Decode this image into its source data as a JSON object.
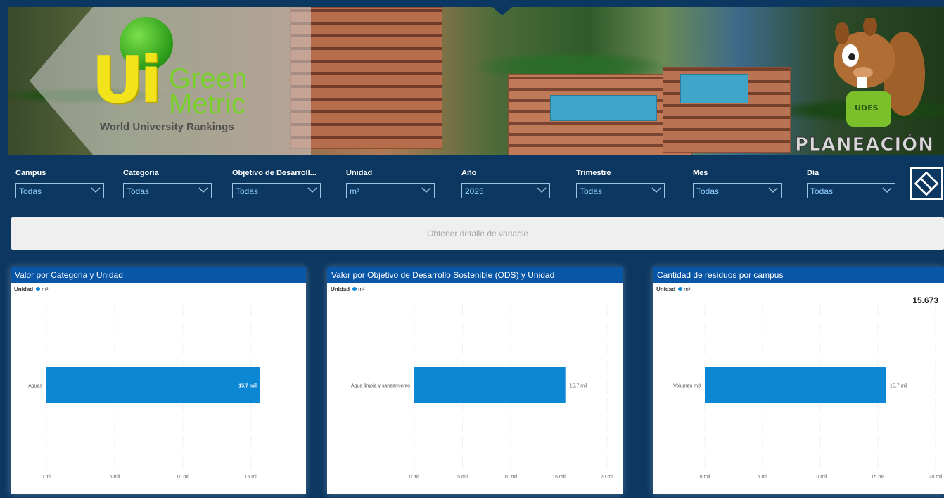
{
  "banner": {
    "logo_ui": "Ui",
    "logo_green": "Green",
    "logo_metric": "Metric",
    "logo_subtitle": "World University Rankings",
    "mascot_shirt": "UDES",
    "section_title": "PLANEACIÓN"
  },
  "filters": [
    {
      "label": "Campus",
      "value": "Todas"
    },
    {
      "label": "Categoria",
      "value": "Todas"
    },
    {
      "label": "Objetivo de Desarroll...",
      "value": "Todas"
    },
    {
      "label": "Unidad",
      "value": "m³"
    },
    {
      "label": "Año",
      "value": "2025"
    },
    {
      "label": "Trimestre",
      "value": "Todas"
    },
    {
      "label": "Mes",
      "value": "Todas"
    },
    {
      "label": "Día",
      "value": "Todas"
    }
  ],
  "clear_filters_icon": "eraser-icon",
  "detail_button": "Obtener detalle de variable",
  "colors": {
    "header": "#0a56a6",
    "bar": "#0c87d4",
    "background": "#0b3760"
  },
  "cards": [
    {
      "title": "Valor por Categoria y Unidad",
      "legend_title": "Unidad",
      "legend_item": "m³",
      "kpi": ""
    },
    {
      "title": "Valor por Objetivo de Desarrollo Sostenible (ODS) y Unidad",
      "legend_title": "Unidad",
      "legend_item": "m³",
      "kpi": ""
    },
    {
      "title": "Cantidad de residuos por campus",
      "legend_title": "Unidad",
      "legend_item": "m³",
      "kpi": "15.673"
    }
  ],
  "chart_data": [
    {
      "type": "bar",
      "orientation": "horizontal",
      "categories": [
        "Aguas"
      ],
      "series": [
        {
          "name": "m³",
          "values": [
            15673
          ]
        }
      ],
      "data_labels": [
        "15,7 mil"
      ],
      "xticks": [
        "0 mil",
        "5 mil",
        "10 mil",
        "15 mil"
      ],
      "xlim": [
        0,
        16500
      ],
      "grid": true
    },
    {
      "type": "bar",
      "orientation": "horizontal",
      "categories": [
        "Agua limpia y saneamiento"
      ],
      "series": [
        {
          "name": "m³",
          "values": [
            15673
          ]
        }
      ],
      "data_labels": [
        "15,7 mil"
      ],
      "xticks": [
        "0 mil",
        "5 mil",
        "10 mil",
        "15 mil",
        "20 mil"
      ],
      "xlim": [
        0,
        20000
      ],
      "grid": true
    },
    {
      "type": "bar",
      "orientation": "horizontal",
      "categories": [
        "Volumen m3"
      ],
      "series": [
        {
          "name": "m³",
          "values": [
            15673
          ]
        }
      ],
      "data_labels": [
        "15,7 mil"
      ],
      "xticks": [
        "0 mil",
        "5 mil",
        "10 mil",
        "15 mil",
        "20 mil"
      ],
      "xlim": [
        0,
        20000
      ],
      "grid": true
    }
  ]
}
